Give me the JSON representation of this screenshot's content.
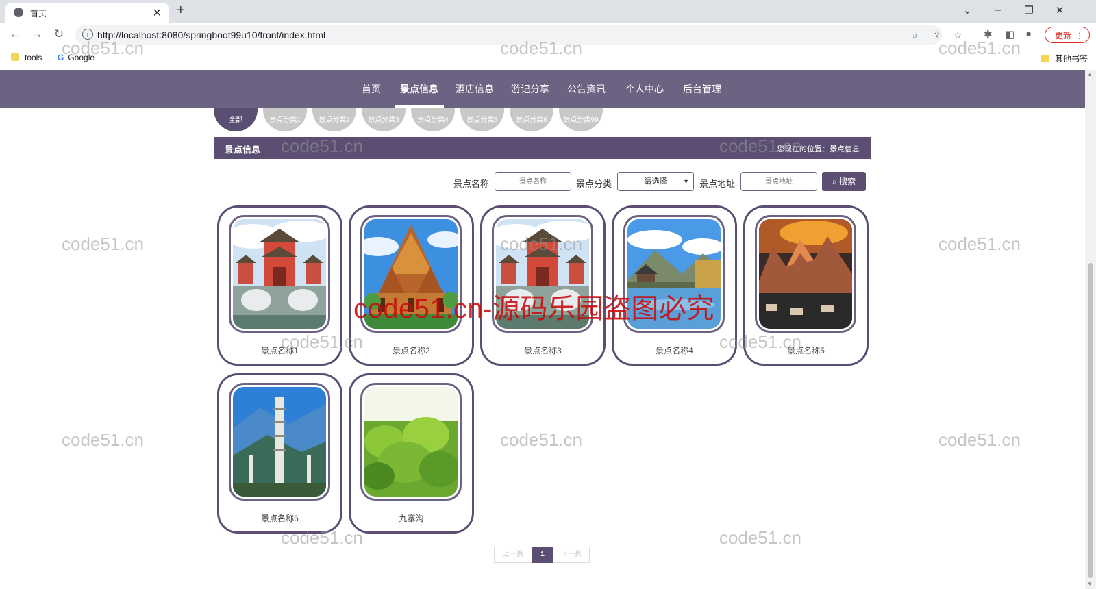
{
  "browser": {
    "tab_title": "首页",
    "url": "http://localhost:8080/springboot99u10/front/index.html",
    "update_label": "更新",
    "bookmarks": [
      "tools",
      "Google"
    ],
    "other_bookmarks": "其他书签"
  },
  "nav": {
    "items": [
      "首页",
      "景点信息",
      "酒店信息",
      "游记分享",
      "公告资讯",
      "个人中心",
      "后台管理"
    ],
    "active": "景点信息"
  },
  "categories": [
    "全部",
    "景点分类1",
    "景点分类2",
    "景点分类3",
    "景点分类4",
    "景点分类5",
    "景点分类6",
    "景点分类99"
  ],
  "section": {
    "title": "景点信息",
    "breadcrumb": "您现在的位置：景点信息"
  },
  "filters": {
    "name_label": "景点名称",
    "name_placeholder": "景点名称",
    "category_label": "景点分类",
    "category_selected": "请选择",
    "address_label": "景点地址",
    "address_placeholder": "景点地址",
    "search_label": "搜索"
  },
  "spots": [
    {
      "name": "景点名称1",
      "image": "pagoda-gate"
    },
    {
      "name": "景点名称2",
      "image": "ornate-temple"
    },
    {
      "name": "景点名称3",
      "image": "pagoda-gate"
    },
    {
      "name": "景点名称4",
      "image": "lake-pavilion"
    },
    {
      "name": "景点名称5",
      "image": "sunset-mountains"
    },
    {
      "name": "景点名称6",
      "image": "three-pagodas"
    },
    {
      "name": "九寨沟",
      "image": "tea-plants"
    }
  ],
  "pagination": {
    "prev": "上一页",
    "current": "1",
    "next": "下一页"
  },
  "watermarks": {
    "text": "code51.cn",
    "red_text": "code51.cn-源码乐园盗图必究"
  },
  "colors": {
    "nav_bg": "#6c6282",
    "accent": "#5b4e72",
    "watermark_red": "#c80a0a"
  }
}
